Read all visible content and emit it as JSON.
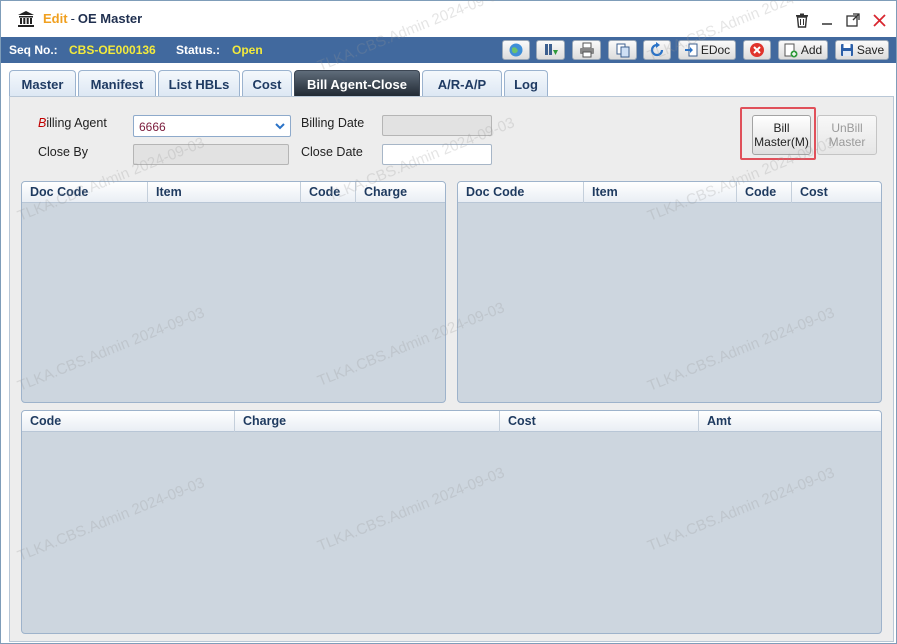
{
  "title": {
    "mode": "Edit",
    "separator": "-",
    "name": "OE Master"
  },
  "info": {
    "seq_label": "Seq No.:",
    "seq_value": "CBS-OE000136",
    "status_label": "Status.:",
    "status_value": "Open"
  },
  "toolbar": {
    "edoc_label": "EDoc",
    "add_label": "Add",
    "save_label": "Save"
  },
  "tabs": [
    {
      "label": "Master"
    },
    {
      "label": "Manifest"
    },
    {
      "label": "List HBLs"
    },
    {
      "label": "Cost"
    },
    {
      "label": "Bill Agent-Close",
      "active": true
    },
    {
      "label": "A/R-A/P"
    },
    {
      "label": "Log"
    }
  ],
  "form": {
    "billing_agent_label_first": "B",
    "billing_agent_label_rest": "illing Agent",
    "billing_agent_value": "6666",
    "billing_date_label": "Billing Date",
    "close_by_label": "Close By",
    "close_date_label": "Close Date"
  },
  "buttons": {
    "bill_master_line1": "Bill",
    "bill_master_line2": "Master(M)",
    "unbill_master_line1": "UnBill",
    "unbill_master_line2": "Master"
  },
  "grid_charge": {
    "columns": [
      "Doc Code",
      "Item",
      "Code",
      "Charge"
    ]
  },
  "grid_cost": {
    "columns": [
      "Doc Code",
      "Item",
      "Code",
      "Cost"
    ]
  },
  "grid_summary": {
    "columns": [
      "Code",
      "Charge",
      "Cost",
      "Amt"
    ]
  },
  "watermark_text": "TLKA.CBS.Admin 2024-09-03",
  "colors": {
    "infobar": "#41699e",
    "accent_yellow": "#f3ea3c",
    "edit_orange": "#f0a020",
    "highlight_red": "#e0505a"
  }
}
